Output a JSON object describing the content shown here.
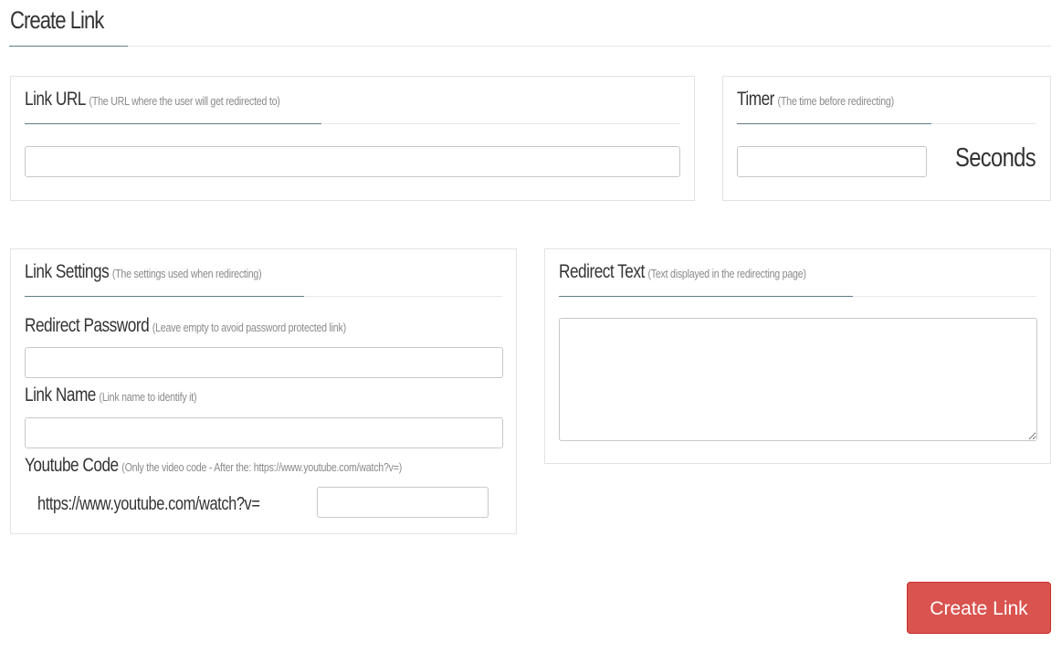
{
  "page": {
    "title": "Create Link"
  },
  "link_url": {
    "label": "Link URL",
    "hint": "(The URL where the user will get redirected to)",
    "value": ""
  },
  "timer": {
    "label": "Timer",
    "hint": "(The time before redirecting)",
    "value": "",
    "unit": "Seconds"
  },
  "link_settings": {
    "label": "Link Settings",
    "hint": "(The settings used when redirecting)",
    "password": {
      "label": "Redirect Password",
      "hint": "(Leave empty to avoid password protected link)",
      "value": ""
    },
    "name": {
      "label": "Link Name",
      "hint": "(Link name to identify it)",
      "value": ""
    },
    "youtube": {
      "label": "Youtube Code",
      "hint": "(Only the video code - After the: https://www.youtube.com/watch?v=)",
      "prefix": "https://www.youtube.com/watch?v=",
      "value": ""
    }
  },
  "redirect_text": {
    "label": "Redirect Text",
    "hint": "(Text displayed in the redirecting page)",
    "value": ""
  },
  "actions": {
    "create_label": "Create Link",
    "create_color": "#d9534f"
  }
}
